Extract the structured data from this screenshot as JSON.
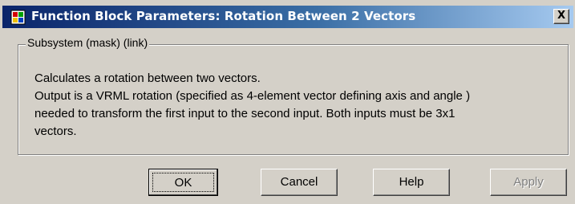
{
  "window": {
    "title": "Function Block Parameters: Rotation Between 2 Vectors",
    "close_label": "X",
    "icon": "simulink-block-icon"
  },
  "group": {
    "legend": "Subsystem (mask) (link)",
    "description_lines": [
      "Calculates a rotation between two vectors.",
      "Output is a VRML rotation (specified as 4-element vector defining axis and angle )",
      "needed to transform the first input to the second input. Both inputs must be 3x1",
      "vectors."
    ]
  },
  "buttons": {
    "ok": "OK",
    "cancel": "Cancel",
    "help": "Help",
    "apply": "Apply"
  },
  "colors": {
    "titlebar_start": "#0a246a",
    "titlebar_end": "#a6caf0",
    "dialog_bg": "#d4d0c8"
  }
}
